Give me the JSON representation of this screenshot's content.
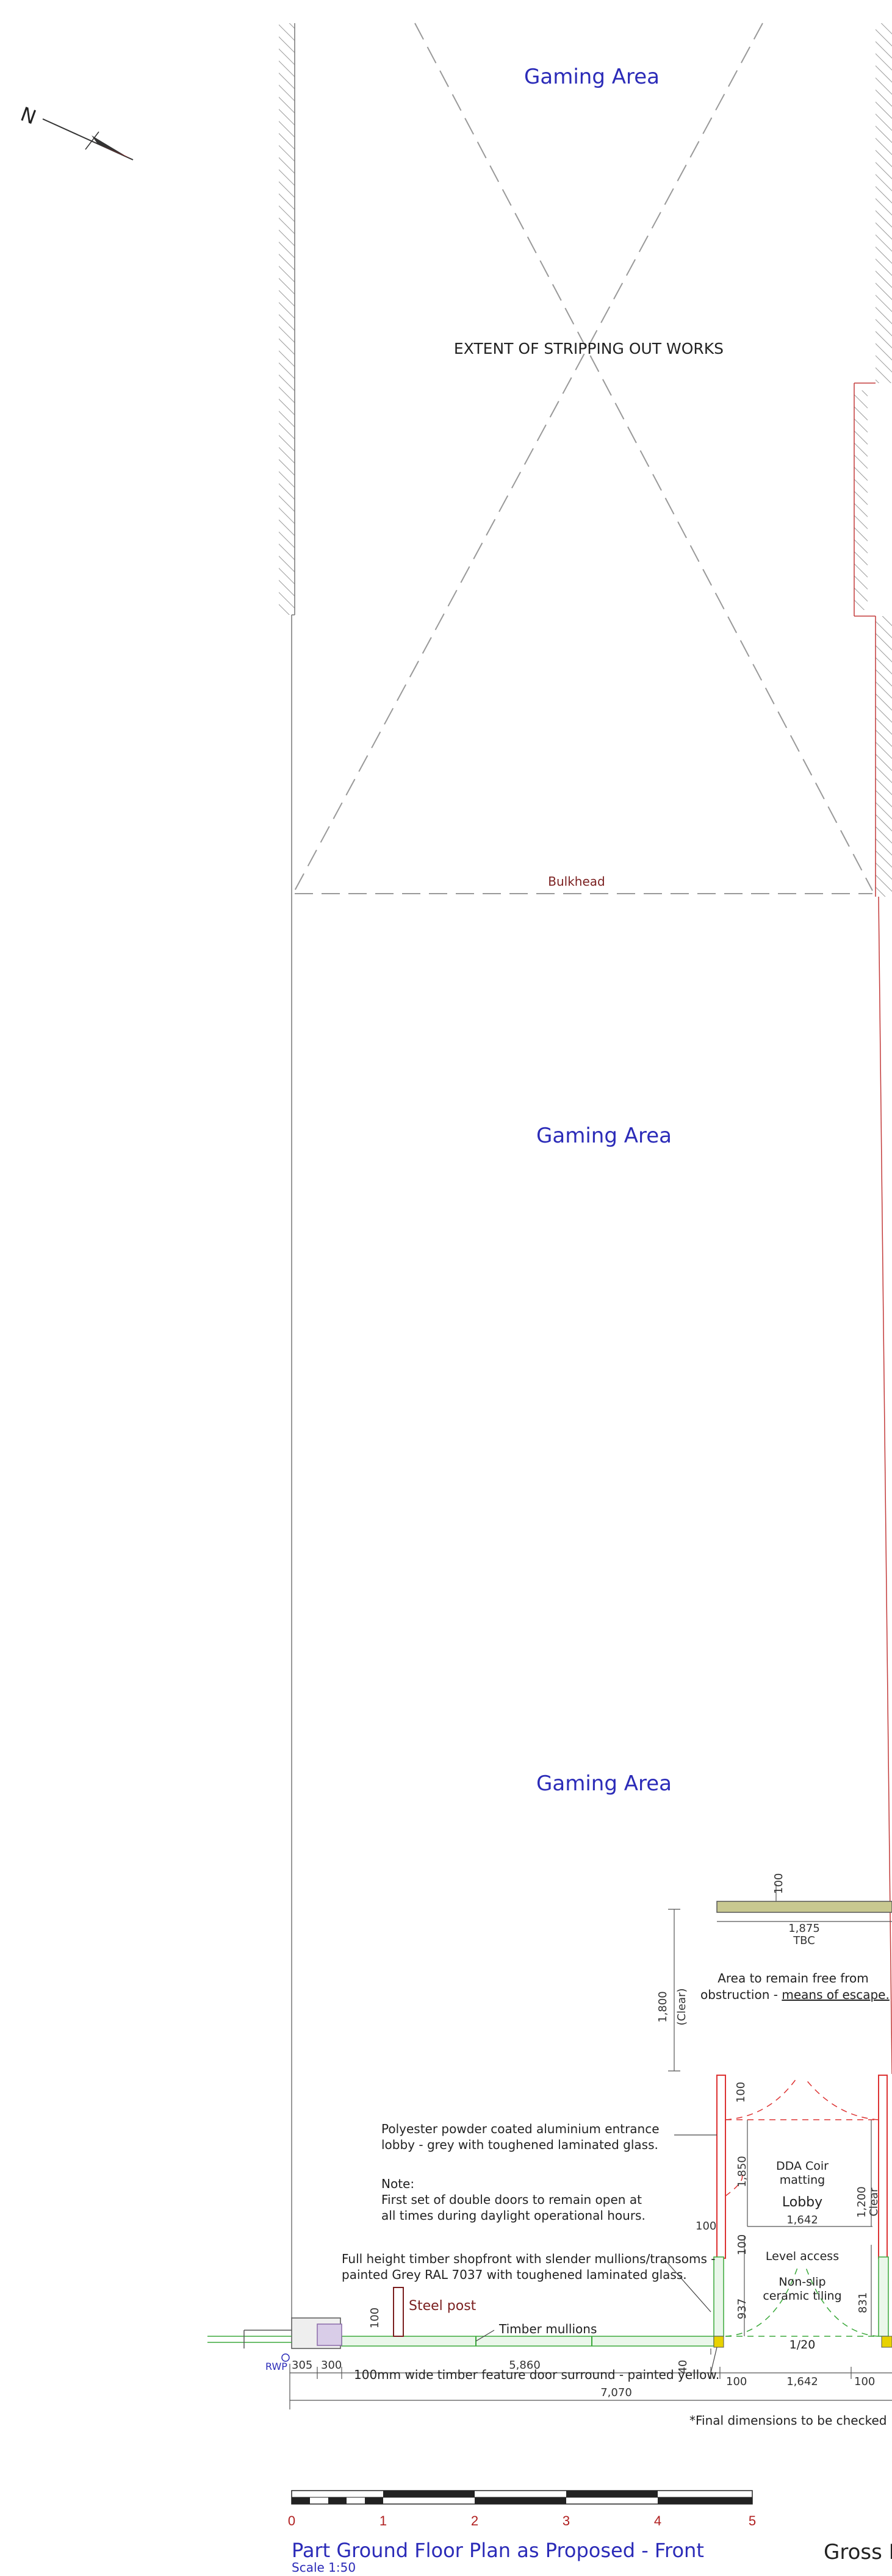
{
  "rooms": {
    "gaming_area_1": "Gaming Area",
    "gaming_area_2": "Gaming Area",
    "gaming_area_3": "Gaming Area",
    "lobby": "Lobby"
  },
  "notes": {
    "stripping": "EXTENT OF STRIPPING OUT WORKS",
    "bulkhead": "Bulkhead",
    "escape_1": "Area to remain free from",
    "escape_2_prefix": "obstruction - ",
    "escape_2_link": "means of escape.",
    "lobby_note_1": "Polyester powder coated aluminium entrance",
    "lobby_note_2": "lobby - grey with toughened laminated glass.",
    "note_heading": "Note:",
    "note_1": "First set of double doors to remain open at",
    "note_2": "all times during daylight operational hours.",
    "shopfront_1": "Full height timber shopfront with slender mullions/transoms -",
    "shopfront_2": "painted Grey RAL 7037 with toughened laminated glass.",
    "steel_post": "Steel post",
    "timber_mullions": "Timber mullions",
    "door_surround": "100mm wide timber feature door surround - painted yellow.",
    "rwp": "RWP",
    "dda_1": "DDA Coir",
    "dda_2": "matting",
    "level_access": "Level access",
    "nonslip_1": "Non-slip",
    "nonslip_2": "ceramic tiling",
    "gradient": "1/20",
    "final_dims": "*Final dimensions to be checked",
    "gross": "Gross I"
  },
  "dimensions": {
    "d100_top": "100",
    "d1875": "1,875",
    "tbc": "TBC",
    "d1800": "1,800",
    "clear": "(Clear)",
    "d100_lobby": "100",
    "d1850": "1,850",
    "d1642_a": "1,642",
    "d100_left": "100",
    "d1200": "1,200",
    "clear_b": "Clear",
    "d100_mid": "100",
    "d937": "937",
    "d831": "831",
    "d100_post": "100",
    "d40": "40",
    "d305": "305",
    "d300": "300",
    "d5860": "5,860",
    "d100_b1": "100",
    "d1642_b": "1,642",
    "d100_b2": "100",
    "d7070": "7,070"
  },
  "scale_bar": {
    "ticks": [
      "0",
      "1",
      "2",
      "3",
      "4",
      "5"
    ]
  },
  "title": {
    "main": "Part Ground Floor Plan as Proposed - Front",
    "scale": "Scale 1:50"
  },
  "compass": {
    "letter": "N"
  },
  "colors": {
    "room_label": "#2b2bb8",
    "wall_red": "#c33a3a",
    "door_red": "#d33",
    "glazing_green": "#3aa83a",
    "surround_yellow": "#e8d200",
    "bulkhead_text": "#7a1f1f"
  }
}
